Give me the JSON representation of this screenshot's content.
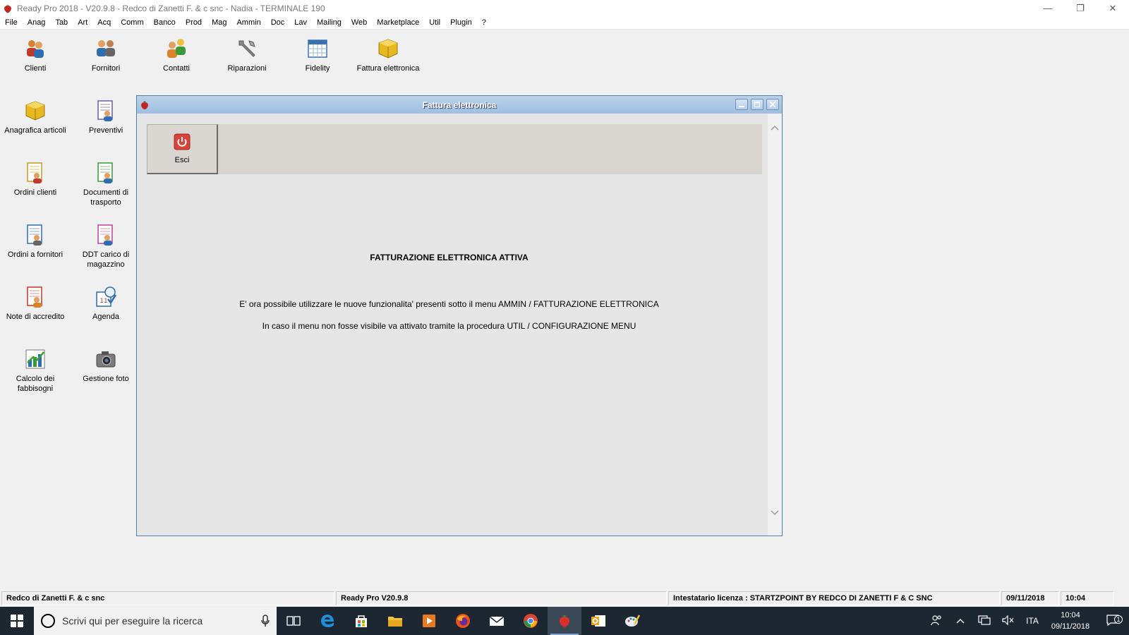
{
  "window": {
    "title": "Ready Pro 2018 - V20.9.8 - Redco di  Zanetti F. & c snc  - Nadia - TERMINALE 190",
    "minimize": "—",
    "restore": "❐",
    "close": "✕"
  },
  "menu": [
    "File",
    "Anag",
    "Tab",
    "Art",
    "Acq",
    "Comm",
    "Banco",
    "Prod",
    "Mag",
    "Ammin",
    "Doc",
    "Lav",
    "Mailing",
    "Web",
    "Marketplace",
    "Util",
    "Plugin",
    "?"
  ],
  "top_icons": [
    {
      "label": "Clienti",
      "icon": "people-icon"
    },
    {
      "label": "Fornitori",
      "icon": "suppliers-icon"
    },
    {
      "label": "Contatti",
      "icon": "contacts-icon"
    },
    {
      "label": "Riparazioni",
      "icon": "wrench-icon"
    },
    {
      "label": "Fidelity",
      "icon": "calendar-icon"
    },
    {
      "label": "Fattura elettronica",
      "icon": "cube-icon"
    }
  ],
  "side_icons": [
    {
      "label": "Anagrafica articoli",
      "icon": "cube-icon"
    },
    {
      "label": "Preventivi",
      "icon": "document-people-icon"
    },
    {
      "label": "Ordini clienti",
      "icon": "document-people-icon"
    },
    {
      "label": "Documenti di trasporto",
      "icon": "document-people-icon"
    },
    {
      "label": "Ordini a fornitori",
      "icon": "document-people-icon"
    },
    {
      "label": "DDT carico di magazzino",
      "icon": "document-people-icon"
    },
    {
      "label": "Note di accredito",
      "icon": "document-people-icon"
    },
    {
      "label": "Agenda",
      "icon": "agenda-icon"
    },
    {
      "label": "Calcolo dei fabbisogni",
      "icon": "chart-icon"
    },
    {
      "label": "Gestione foto",
      "icon": "camera-icon"
    }
  ],
  "dialog": {
    "title": "Fattura elettronica",
    "exit_label": "Esci",
    "heading": "FATTURAZIONE ELETTRONICA ATTIVA",
    "line1": "E' ora possibile utilizzare le nuove funzionalita' presenti sotto il menu AMMIN / FATTURAZIONE ELETTRONICA",
    "line2": "In caso il menu non fosse visibile va attivato tramite la procedura UTIL / CONFIGURAZIONE MENU"
  },
  "statusbar": {
    "company": "Redco di  Zanetti F. & c snc",
    "version": "Ready Pro V20.9.8",
    "license": "Intestatario licenza : STARTZPOINT BY REDCO DI ZANETTI F & C SNC",
    "date": "09/11/2018",
    "time": "10:04"
  },
  "taskbar": {
    "search_placeholder": "Scrivi qui per eseguire la ricerca",
    "language": "ITA",
    "clock_time": "10:04",
    "clock_date": "09/11/2018",
    "notification_count": "1"
  }
}
